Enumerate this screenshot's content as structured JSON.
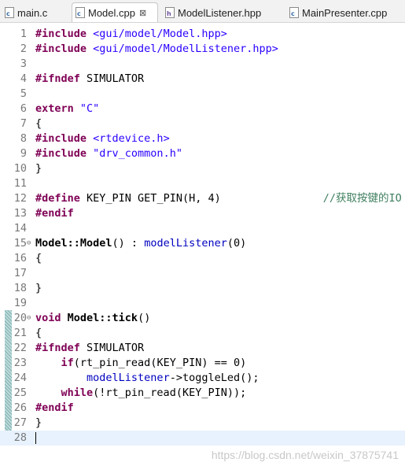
{
  "tabs": [
    {
      "label": "main.c",
      "icon": "c-file-icon",
      "active": false
    },
    {
      "label": "Model.cpp",
      "icon": "c-file-icon",
      "active": true
    },
    {
      "label": "ModelListener.hpp",
      "icon": "h-file-icon",
      "active": false
    },
    {
      "label": "MainPresenter.cpp",
      "icon": "c-file-icon",
      "active": false
    }
  ],
  "close_glyph": "⊠",
  "line_numbers": [
    "1",
    "2",
    "3",
    "4",
    "5",
    "6",
    "7",
    "8",
    "9",
    "10",
    "11",
    "12",
    "13",
    "14",
    "15",
    "16",
    "17",
    "18",
    "19",
    "20",
    "21",
    "22",
    "23",
    "24",
    "25",
    "26",
    "27",
    "28"
  ],
  "code": {
    "l1_kw": "#include",
    "l1_str": " <gui/model/Model.hpp>",
    "l2_kw": "#include",
    "l2_str": " <gui/model/ModelListener.hpp>",
    "l4_kw": "#ifndef",
    "l4_txt": " SIMULATOR",
    "l6_kw": "extern",
    "l6_str": " \"C\"",
    "l7": "{",
    "l8_kw": "#include",
    "l8_str": " <rtdevice.h>",
    "l9_kw": "#include",
    "l9_str": " \"drv_common.h\"",
    "l10": "}",
    "l12_kw": "#define",
    "l12_txt": " KEY_PIN GET_PIN(H, 4)                ",
    "l12_cmt": "//获取按键的IO",
    "l13_kw": "#endif",
    "l15_fn": "Model::Model",
    "l15_txt1": "() : ",
    "l15_mem": "modelListener",
    "l15_txt2": "(0)",
    "l16": "{",
    "l18": "}",
    "l20_kw": "void",
    "l20_fn": " Model::tick",
    "l20_txt": "()",
    "l21": "{",
    "l22_kw": "#ifndef",
    "l22_txt": " SIMULATOR",
    "l23_pre": "    ",
    "l23_kw": "if",
    "l23_txt": "(rt_pin_read(KEY_PIN) == 0)",
    "l24_pre": "        ",
    "l24_mem": "modelListener",
    "l24_txt": "->toggleLed();",
    "l25_pre": "    ",
    "l25_kw": "while",
    "l25_txt": "(!rt_pin_read(KEY_PIN));",
    "l26_kw": "#endif",
    "l27": "}"
  },
  "fold_marker": "⊖",
  "watermark": "https://blog.csdn.net/weixin_37875741",
  "colors": {
    "keyword": "#7f0055",
    "string": "#2a00ff",
    "comment": "#3f7f5f",
    "member": "#0000c0",
    "current_line": "#e8f2fe"
  }
}
